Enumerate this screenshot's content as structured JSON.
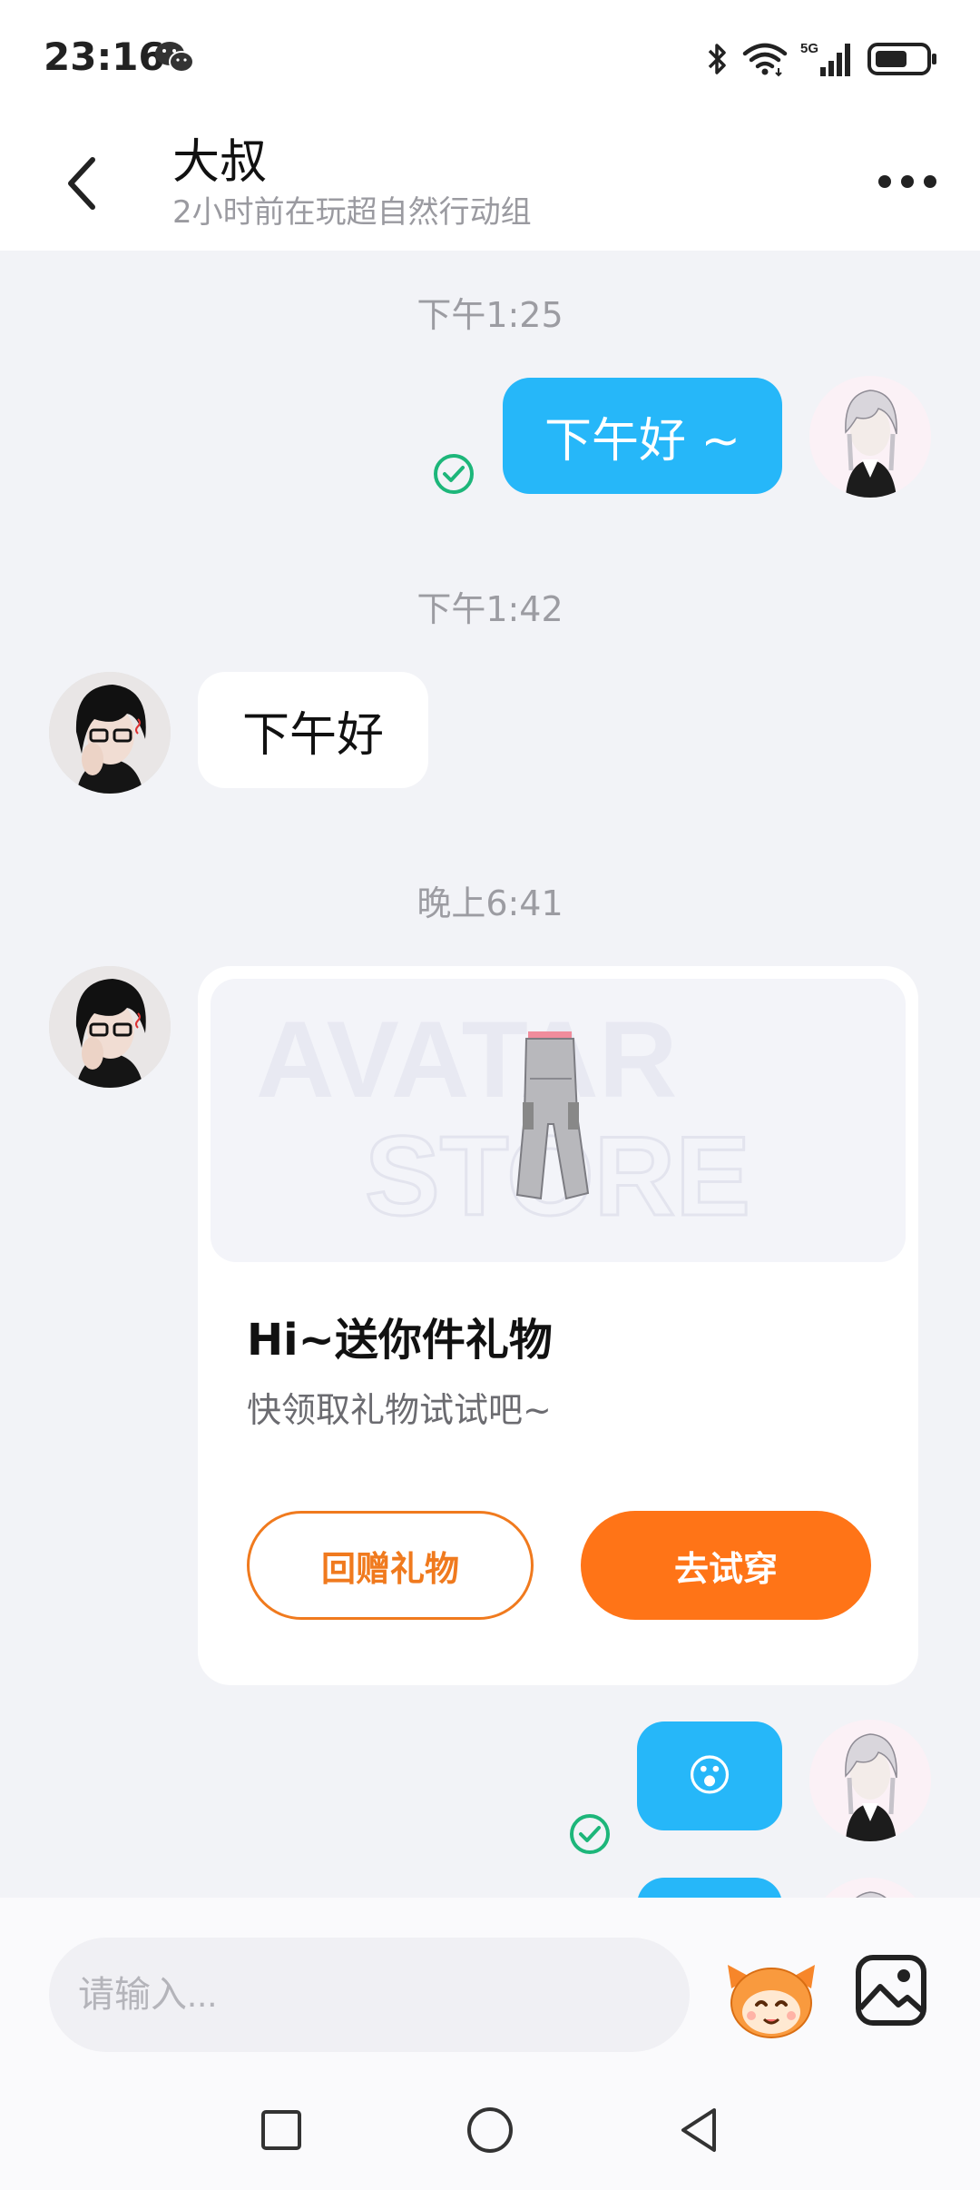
{
  "status_bar": {
    "time": "23:16",
    "icons": [
      "wechat-icon",
      "bluetooth-icon",
      "wifi-icon",
      "signal-5g-icon",
      "battery-icon"
    ],
    "network_label": "5G"
  },
  "header": {
    "title": "大叔",
    "subtitle": "2小时前在玩超自然行动组",
    "back_icon": "chevron-left-icon",
    "more_icon": "more-dots-icon"
  },
  "messages": {
    "ts1": "下午1:25",
    "msg1": "下午好 ~",
    "ts2": "下午1:42",
    "msg2": "下午好",
    "ts3": "晚上6:41",
    "gift": {
      "banner_watermark_1": "AVATAR",
      "banner_watermark_2": "STORE",
      "title": "Hi~送你件礼物",
      "desc": "快领取礼物试试吧~",
      "return_label": "回赠礼物",
      "try_label": "去试穿"
    },
    "msg4": "😮"
  },
  "input": {
    "placeholder": "请输入..."
  },
  "colors": {
    "accent_blue": "#26b7f9",
    "accent_orange": "#ff7417",
    "chat_bg": "#f2f3f7",
    "read_check": "#1db67a"
  }
}
